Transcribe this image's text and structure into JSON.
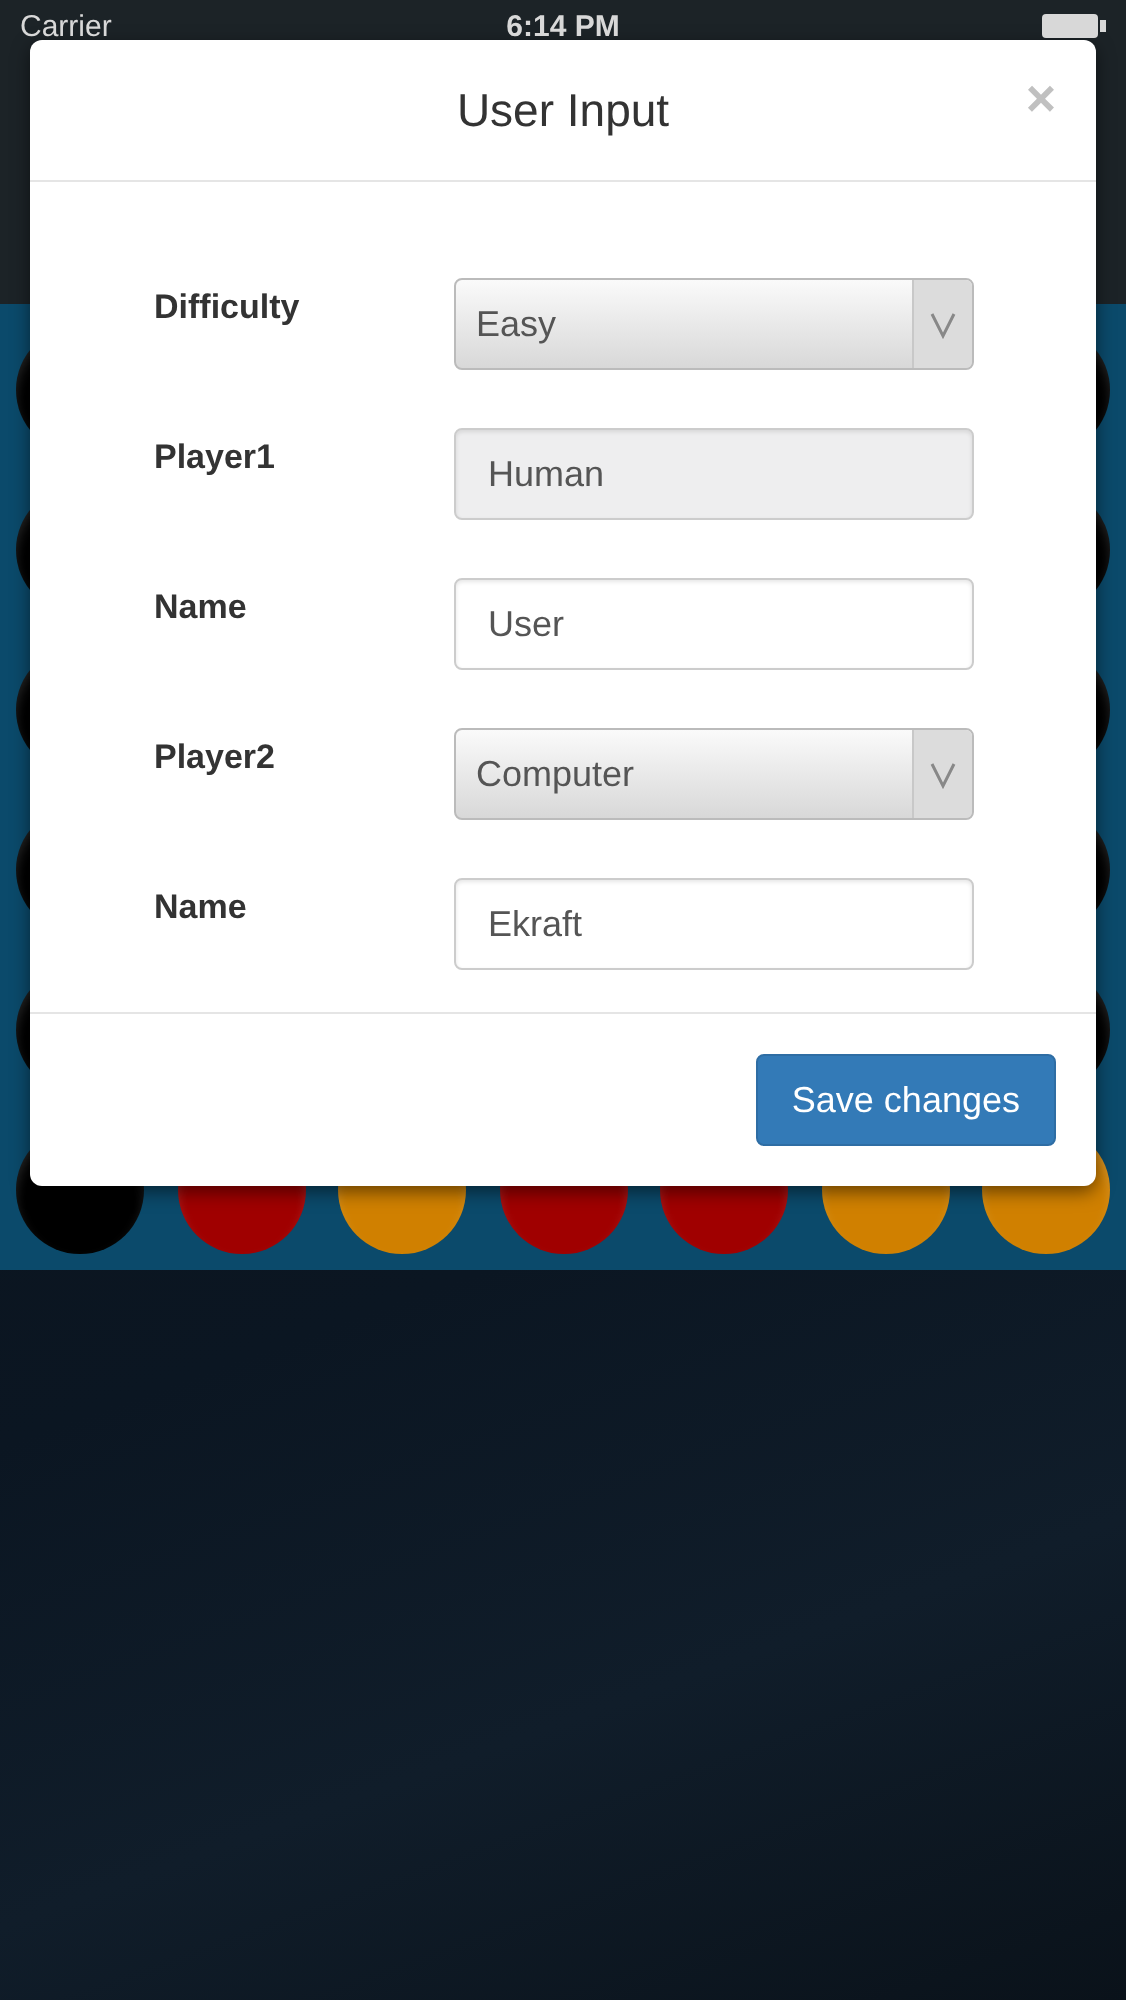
{
  "status_bar": {
    "carrier": "Carrier",
    "time": "6:14 PM"
  },
  "board": {
    "bottom_row": [
      {
        "color": "#000000"
      },
      {
        "color": "#a00000"
      },
      {
        "color": "#d08000"
      },
      {
        "color": "#a00000"
      },
      {
        "color": "#a00000"
      },
      {
        "color": "#d08000"
      },
      {
        "color": "#d08000"
      }
    ]
  },
  "modal": {
    "title": "User Input",
    "close": "×",
    "fields": [
      {
        "label": "Difficulty",
        "kind": "select",
        "value": "Easy",
        "disabled": false
      },
      {
        "label": "Player1",
        "kind": "text",
        "value": "Human",
        "disabled": true
      },
      {
        "label": "Name",
        "kind": "text",
        "value": "User",
        "disabled": false
      },
      {
        "label": "Player2",
        "kind": "select",
        "value": "Computer",
        "disabled": false
      },
      {
        "label": "Name",
        "kind": "text",
        "value": "Ekraft",
        "disabled": false
      }
    ],
    "save_button": "Save changes"
  }
}
